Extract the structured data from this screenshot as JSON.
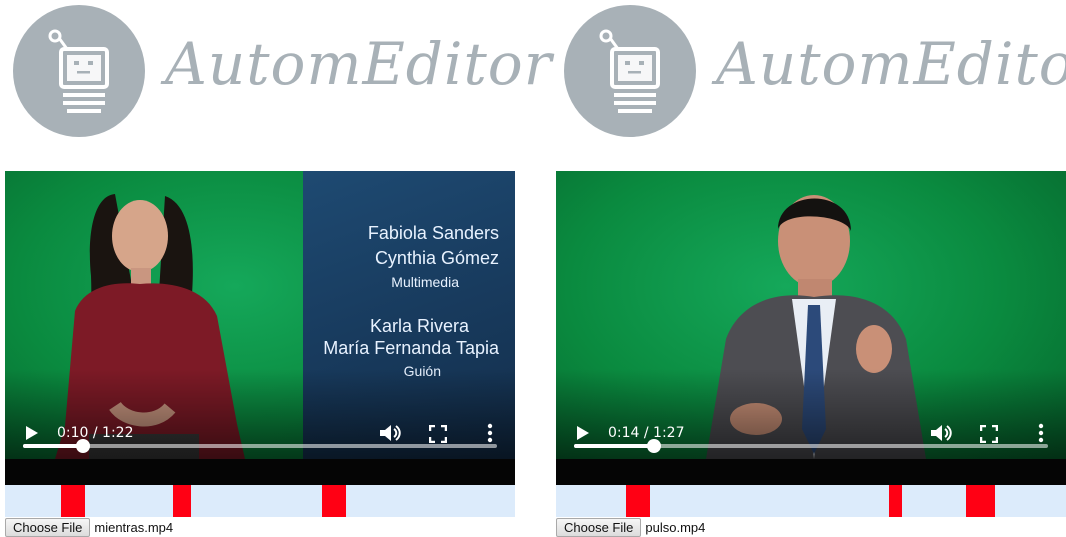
{
  "players": [
    {
      "logo_text": "AutomEditor",
      "credits": [
        "Fabiola Sanders",
        "Cynthia Gómez",
        "Multimedia",
        "Karla Rivera",
        "María Fernanda Tapia",
        "Guión"
      ],
      "time": "0:10 / 1:22",
      "progress": 0.126,
      "markers": [
        {
          "start": 0.11,
          "end": 0.157
        },
        {
          "start": 0.329,
          "end": 0.365
        },
        {
          "start": 0.621,
          "end": 0.668
        }
      ],
      "file_button": "Choose File",
      "file_name": "mientras.mp4"
    },
    {
      "logo_text": "AutomEditor",
      "time": "0:14 / 1:27",
      "progress": 0.169,
      "markers": [
        {
          "start": 0.137,
          "end": 0.184
        },
        {
          "start": 0.653,
          "end": 0.678
        },
        {
          "start": 0.804,
          "end": 0.86
        }
      ],
      "file_button": "Choose File",
      "file_name": "pulso.mp4"
    }
  ]
}
